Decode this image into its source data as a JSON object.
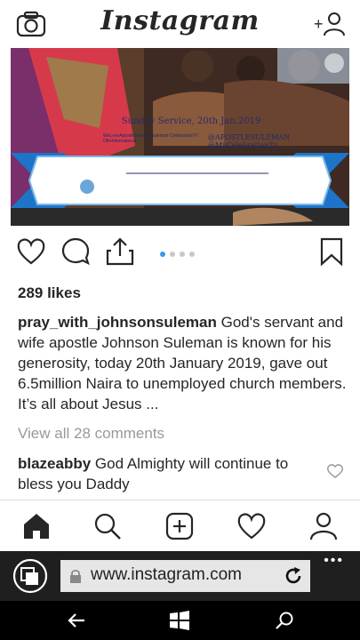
{
  "header": {
    "logo_text": "Instagram",
    "camera_icon": "camera-icon",
    "add_user_icon": "add-user-icon"
  },
  "post": {
    "image_banner": {
      "title": "Sunday Service, 20th Jan.2019",
      "left_text": "WeLoveApostleJohnsonSuleman CelebrationTV OfmInternational",
      "right_text": "@APOSTLESULEMAN @MyCelebrationTv"
    },
    "carousel": {
      "count": 4,
      "active_index": 0
    },
    "likes": "289 likes",
    "caption": {
      "username": "pray_with_johnsonsuleman",
      "text": " God's servant and wife apostle Johnson Suleman is known for his generosity, today 20th January 2019, gave out 6.5million Naira to unemployed church members. It’s all about Jesus ..."
    },
    "view_all_comments": "View all 28 comments",
    "comment": {
      "username": "blazeabby",
      "text": " God Almighty will continue to bless you Daddy"
    }
  },
  "bottom_nav": [
    "home-icon",
    "search-icon",
    "new-post-icon",
    "activity-heart-icon",
    "profile-icon"
  ],
  "browser": {
    "url": "www.instagram.com",
    "more_label": "•••"
  },
  "colors": {
    "accent": "#3897f0",
    "text": "#262626",
    "muted": "#999999",
    "browser_bar": "#1f1f1f"
  }
}
